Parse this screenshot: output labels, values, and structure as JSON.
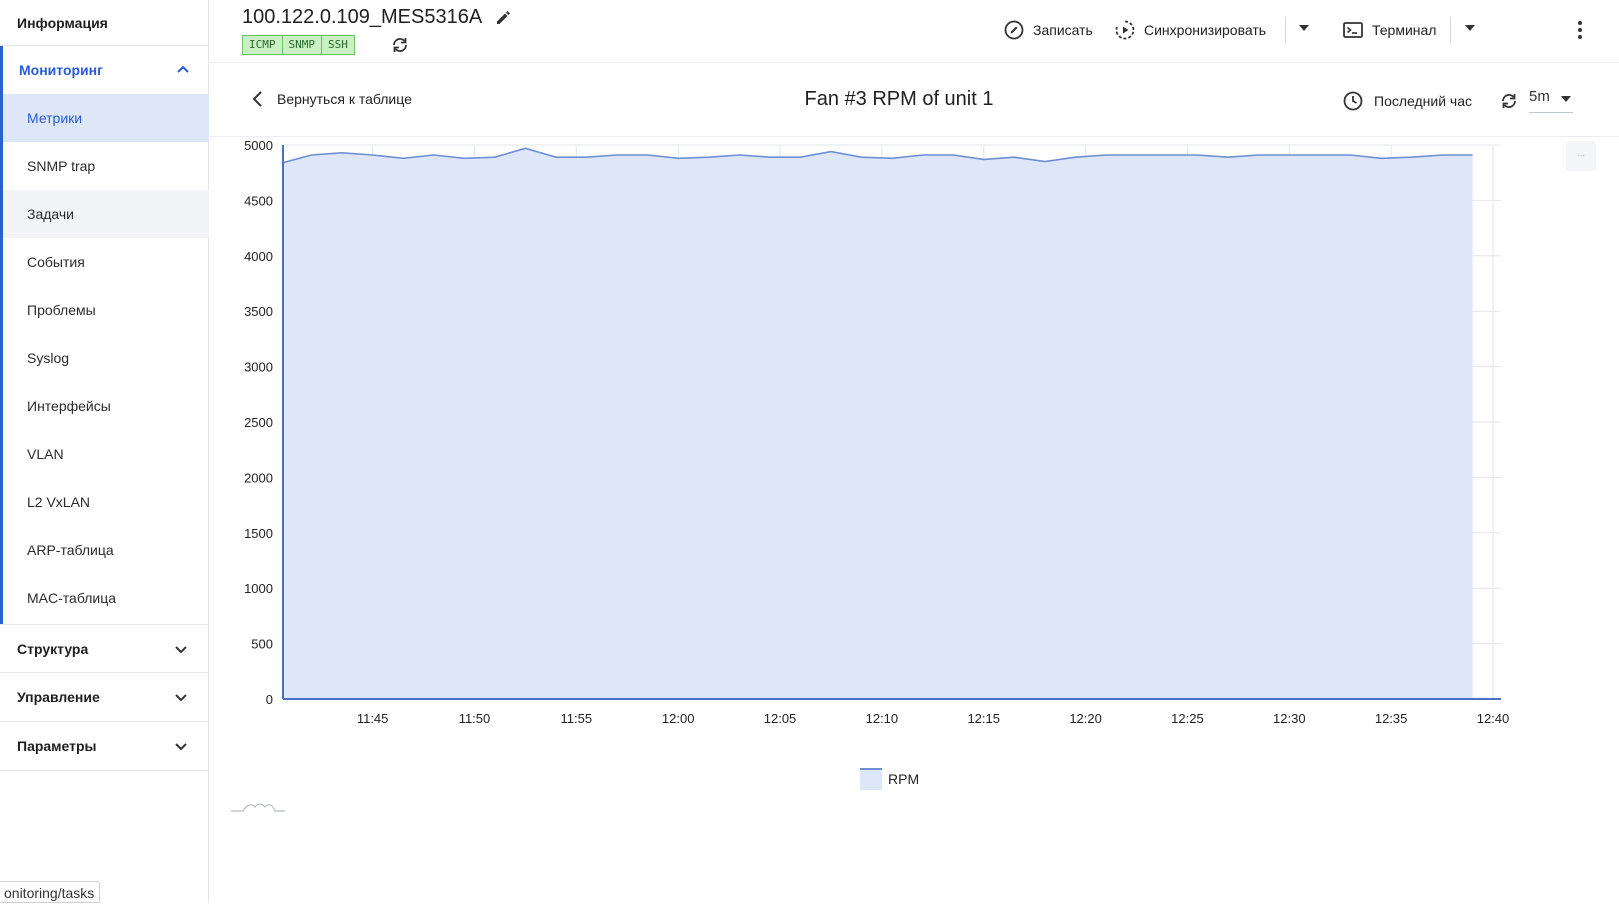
{
  "sidebar": {
    "info": "Информация",
    "monitoring": {
      "title": "Мониторинг",
      "items": [
        "Метрики",
        "SNMP trap",
        "Задачи",
        "События",
        "Проблемы",
        "Syslog",
        "Интерфейсы",
        "VLAN",
        "L2 VxLAN",
        "ARP-таблица",
        "MAC-таблица"
      ]
    },
    "structure": "Структура",
    "management": "Управление",
    "parameters": "Параметры",
    "url_tooltip": "onitoring/tasks"
  },
  "header": {
    "device_title": "100.122.0.109_MES5316A",
    "protocols": [
      "ICMP",
      "SNMP",
      "SSH"
    ],
    "record_label": "Записать",
    "sync_label": "Синхронизировать",
    "terminal_label": "Терминал"
  },
  "chart_header": {
    "back_label": "Вернуться к таблице",
    "title": "Fan #3 RPM of unit 1",
    "time_range": "Последний час",
    "refresh_interval": "5m",
    "corner_button": "..."
  },
  "colors": {
    "accent": "#2a5bd7",
    "series_line": "#6f8fd4",
    "series_fill": "#dde7f8",
    "protocol_badge_bg": "#c8f0c3"
  },
  "icons": [
    "pencil-icon",
    "sync-icon",
    "record-icon",
    "play-sync-icon",
    "terminal-icon",
    "kebab-icon",
    "chevron-left-icon",
    "clock-icon",
    "refresh-icon",
    "chevron-up-icon",
    "chevron-down-icon",
    "sparkline-icon"
  ],
  "chart_data": {
    "type": "area",
    "title": "Fan #3 RPM of unit 1",
    "xlabel": "",
    "ylabel": "",
    "ylim": [
      0,
      5000
    ],
    "yticks": [
      0,
      500,
      1000,
      1500,
      2000,
      2500,
      3000,
      3500,
      4000,
      4500,
      5000
    ],
    "xticks": [
      "11:45",
      "11:50",
      "11:55",
      "12:00",
      "12:05",
      "12:10",
      "12:15",
      "12:20",
      "12:25",
      "12:30",
      "12:35",
      "12:40"
    ],
    "x_minutes_from": "11:40.6",
    "grid": true,
    "legend_position": "bottom-center",
    "series": [
      {
        "name": "RPM",
        "x": [
          "11:40.6",
          "11:42",
          "11:43.5",
          "11:45",
          "11:46.5",
          "11:48",
          "11:49.5",
          "11:51",
          "11:52.5",
          "11:54",
          "11:55.5",
          "11:57",
          "11:58.5",
          "12:00",
          "12:01.5",
          "12:03",
          "12:04.5",
          "12:06",
          "12:07.5",
          "12:09",
          "12:10.5",
          "12:12",
          "12:13.5",
          "12:15",
          "12:16.5",
          "12:18",
          "12:19.5",
          "12:21",
          "12:22.5",
          "12:24",
          "12:25.5",
          "12:27",
          "12:28.5",
          "12:30",
          "12:31.5",
          "12:33",
          "12:34.5",
          "12:36",
          "12:37.5",
          "12:39"
        ],
        "values": [
          4840,
          4910,
          4930,
          4910,
          4880,
          4910,
          4880,
          4890,
          4970,
          4890,
          4890,
          4910,
          4910,
          4880,
          4890,
          4910,
          4890,
          4890,
          4940,
          4890,
          4880,
          4910,
          4910,
          4870,
          4890,
          4850,
          4890,
          4910,
          4910,
          4910,
          4910,
          4890,
          4910,
          4910,
          4910,
          4910,
          4880,
          4890,
          4910,
          4910
        ]
      }
    ]
  }
}
